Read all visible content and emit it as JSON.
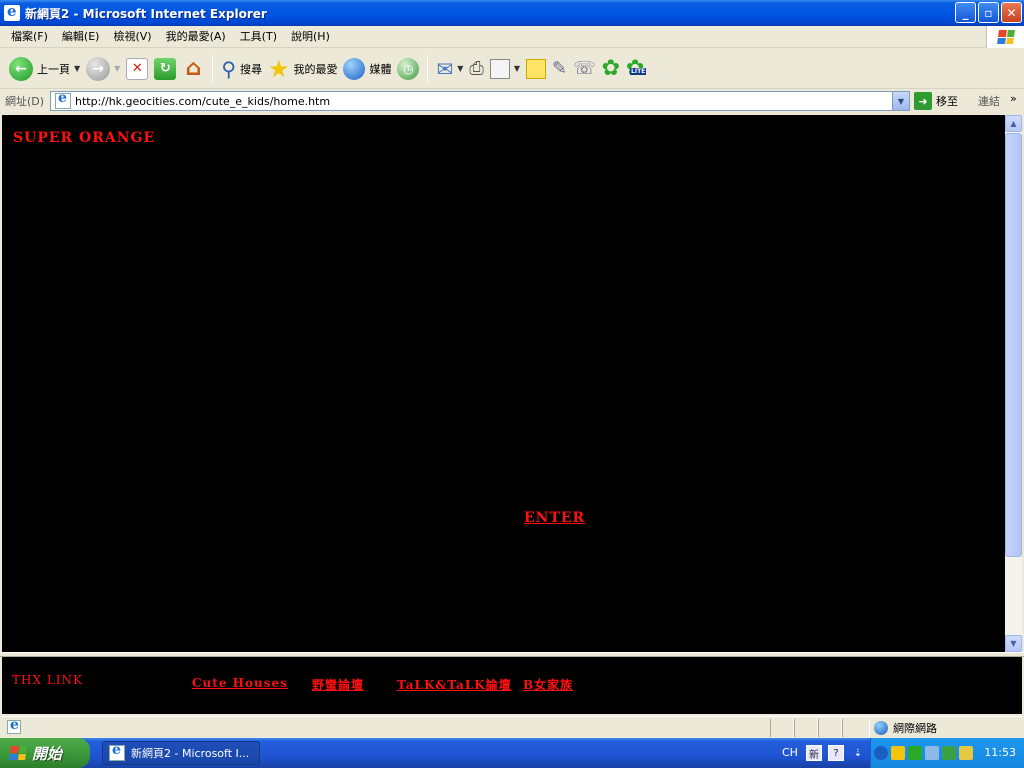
{
  "window": {
    "title": "新網頁2 - Microsoft Internet Explorer",
    "minimize": "_",
    "maximize": "▫",
    "close": "✕"
  },
  "menubar": {
    "items": [
      "檔案(F)",
      "編輯(E)",
      "檢視(V)",
      "我的最愛(A)",
      "工具(T)",
      "說明(H)"
    ]
  },
  "toolbar": {
    "back_label": "上一頁",
    "search_label": "搜尋",
    "favorites_label": "我的最愛",
    "media_label": "媒體",
    "lite_badge": "LITE"
  },
  "address": {
    "label": "網址(D)",
    "url": "http://hk.geocities.com/cute_e_kids/home.htm",
    "go_label": "移至",
    "links_label": "連結"
  },
  "page": {
    "heading": "SUPER ORANGE",
    "enter_link": "ENTER",
    "thanks_label": "THX LINK",
    "links": [
      {
        "label": "Cute Houses"
      },
      {
        "label": "野蠻論壇"
      },
      {
        "label": "TaLK&TaLK論壇"
      },
      {
        "label": "B女家族"
      }
    ]
  },
  "statusbar": {
    "zone": "網際網路"
  },
  "taskbar": {
    "start_label": "開始",
    "task_title": "新網頁2 - Microsoft I...",
    "language": "CH",
    "clock": "11:53"
  },
  "colors": {
    "page_background": "#000000",
    "link_red": "#ff1010",
    "title_bar_blue": "#0055e5",
    "start_green": "#3c9a3a"
  }
}
